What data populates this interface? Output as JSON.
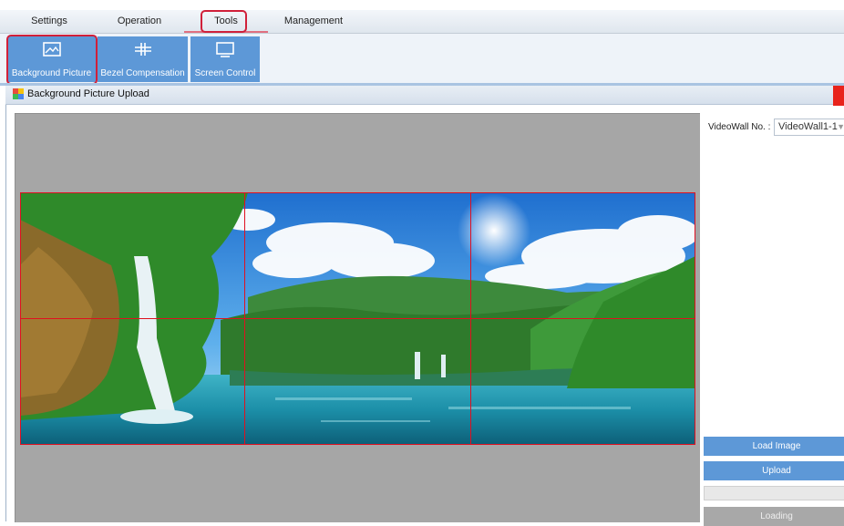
{
  "menu": {
    "tabs": [
      "Settings",
      "Operation",
      "Tools",
      "Management"
    ],
    "active": "Tools"
  },
  "toolbar": {
    "buttons": [
      {
        "label": "Background Picture",
        "icon": "image-icon"
      },
      {
        "label": "Bezel Compensation",
        "icon": "bezel-compensation-icon"
      },
      {
        "label": "Screen Control",
        "icon": "monitor-icon"
      }
    ]
  },
  "panel": {
    "title": "Background Picture Upload"
  },
  "side": {
    "videowall_label": "VideoWall No. :",
    "videowall_value": "VideoWall1-1",
    "load_image": "Load Image",
    "upload": "Upload",
    "loading": "Loading"
  },
  "preview": {
    "grid_rows": 2,
    "grid_cols": 3
  },
  "colors": {
    "accent": "#5d98d7",
    "highlight": "#d0203a",
    "grid_line": "#e01020"
  }
}
